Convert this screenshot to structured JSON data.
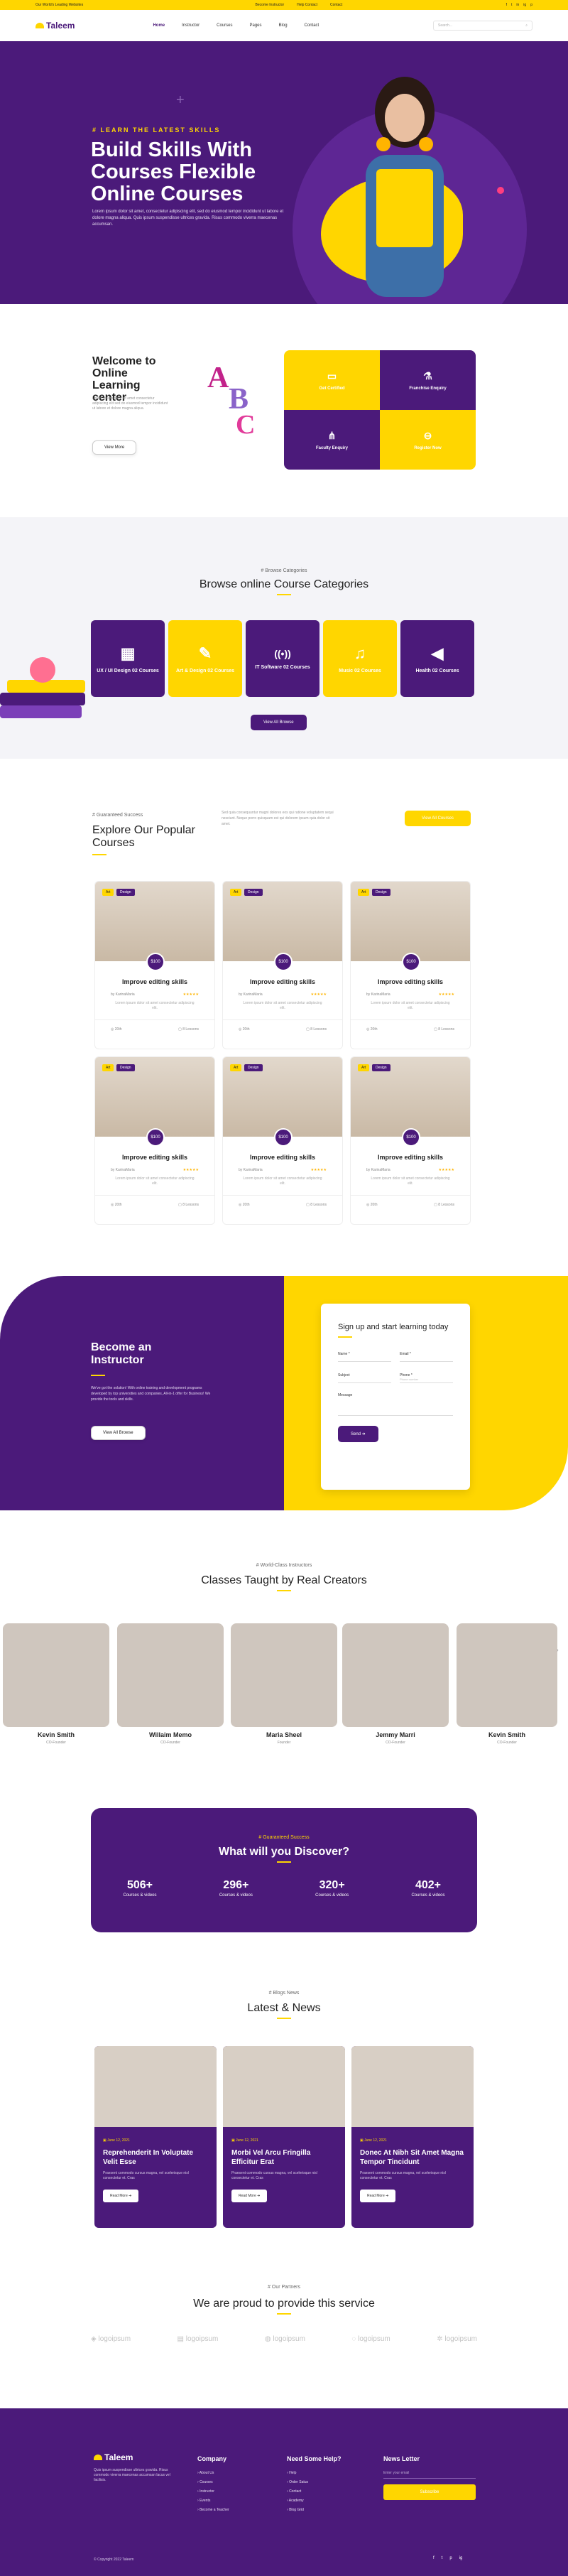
{
  "topbar": {
    "left": "Our World's Leading Websites",
    "links": [
      "Become Instructor",
      "Help Contact",
      "Contact"
    ],
    "social": [
      "f",
      "t",
      "in",
      "ig",
      "p"
    ]
  },
  "nav": {
    "logo": "Taleem",
    "menu": [
      "Home",
      "Instructor",
      "Courses",
      "Pages",
      "Blog",
      "Contact"
    ],
    "search_placeholder": "Search..."
  },
  "hero": {
    "kicker": "# LEARN THE LATEST SKILLS",
    "title": "Build Skills With Courses Flexible Online Courses",
    "text": "Lorem ipsum dolor sit amet, consectetur adipiscing elit, sed do eiusmod tempor incididunt ut labore et dolore magna aliqua. Quis ipsum suspendisse ultrices gravida. Risus commodo viverra maecenas accumsan."
  },
  "welcome": {
    "title": "Welcome to Online Learning center",
    "text": "Lorem ipsum dolor sit amet consectetur adipiscing elit sed do eiusmod tempor incididunt ut labore et dolore magna aliqua.",
    "button": "View More",
    "tiles": [
      {
        "label": "Get Certified",
        "icon": "certificate-icon",
        "glyph": "▭"
      },
      {
        "label": "Franchise Enquiry",
        "icon": "flask-icon",
        "glyph": "⚗"
      },
      {
        "label": "Faculty Enquiry",
        "icon": "network-icon",
        "glyph": "⋔"
      },
      {
        "label": "Register Now",
        "icon": "link-icon",
        "glyph": "⊖"
      }
    ]
  },
  "categories": {
    "kicker": "# Browse Categories",
    "title": "Browse online Course Categories",
    "items": [
      {
        "label": "UX / UI Design 02 Courses",
        "glyph": "▦"
      },
      {
        "label": "Art & Design 02 Courses",
        "glyph": "✎"
      },
      {
        "label": "IT Software 02 Courses",
        "glyph": "((•))"
      },
      {
        "label": "Music 02 Courses",
        "glyph": "♫"
      },
      {
        "label": "Health 02 Courses",
        "glyph": "◀"
      }
    ],
    "button": "View All Browse"
  },
  "courses": {
    "kicker": "# Guaranteed Success",
    "title": "Explore Our Popular Courses",
    "desc": "Sed quia consequuntur magni dolores eos qui ratione voluptatem sequi nesciunt. Neque porro quisquam est qui dolorem ipsum quia dolor sit amet.",
    "button": "View All Courses",
    "cards": [
      {
        "tag1": "Art",
        "tag2": "Design",
        "price": "$100",
        "title": "Improve editing skills",
        "author": "by KarinaMaria",
        "desc": "Lorem ipsum dolor sit amet consectetur adipiscing elit.",
        "students": "20th",
        "lessons": "8 Lessons"
      },
      {
        "tag1": "Art",
        "tag2": "Design",
        "price": "$100",
        "title": "Improve editing skills",
        "author": "by KarinaMaria",
        "desc": "Lorem ipsum dolor sit amet consectetur adipiscing elit.",
        "students": "20th",
        "lessons": "8 Lessons"
      },
      {
        "tag1": "Art",
        "tag2": "Design",
        "price": "$100",
        "title": "Improve editing skills",
        "author": "by KarinaMaria",
        "desc": "Lorem ipsum dolor sit amet consectetur adipiscing elit.",
        "students": "20th",
        "lessons": "8 Lessons"
      },
      {
        "tag1": "Art",
        "tag2": "Design",
        "price": "$100",
        "title": "Improve editing skills",
        "author": "by KarinaMaria",
        "desc": "Lorem ipsum dolor sit amet consectetur adipiscing elit.",
        "students": "20th",
        "lessons": "8 Lessons"
      },
      {
        "tag1": "Art",
        "tag2": "Design",
        "price": "$100",
        "title": "Improve editing skills",
        "author": "by KarinaMaria",
        "desc": "Lorem ipsum dolor sit amet consectetur adipiscing elit.",
        "students": "20th",
        "lessons": "8 Lessons"
      },
      {
        "tag1": "Art",
        "tag2": "Design",
        "price": "$100",
        "title": "Improve editing skills",
        "author": "by KarinaMaria",
        "desc": "Lorem ipsum dolor sit amet consectetur adipiscing elit.",
        "students": "20th",
        "lessons": "8 Lessons"
      }
    ]
  },
  "instructor": {
    "title": "Become an Instructor",
    "text": "We've got the solution! With online training and development programs developed by top universities and companies, All-in-1 offer for Business! We provide the tools and skills.",
    "button": "View All Browse",
    "form_title": "Sign up and start learning today",
    "fields": {
      "name": "Name *",
      "email": "Email *",
      "subject": "Subject",
      "phone": "Phone *",
      "message": "Message"
    },
    "phone_placeholder": "Phone number",
    "send": "Send"
  },
  "teachers": {
    "kicker": "# World-Class Instructors",
    "title": "Classes Taught by Real Creators",
    "items": [
      {
        "name": "Kevin Smith",
        "role": "CO-Founder"
      },
      {
        "name": "Willaim Memo",
        "role": "CO-Founder"
      },
      {
        "name": "Maria Sheel",
        "role": "Founder"
      },
      {
        "name": "Jemmy Marri",
        "role": "CO-Founder"
      },
      {
        "name": "Kevin Smith",
        "role": "CO-Founder"
      }
    ]
  },
  "discover": {
    "kicker": "# Guaranteed Success",
    "title": "What will you Discover?",
    "stats": [
      {
        "n": "506+",
        "l": "Courses & videos"
      },
      {
        "n": "296+",
        "l": "Courses & videos"
      },
      {
        "n": "320+",
        "l": "Courses & videos"
      },
      {
        "n": "402+",
        "l": "Courses & videos"
      }
    ]
  },
  "blog": {
    "kicker": "# Blogs News",
    "title": "Latest & News",
    "items": [
      {
        "date": "June 12, 2021",
        "title": "Reprehenderit In Voluptate Velit Esse",
        "desc": "Praesent commodo cursus magna, vel scelerisque nisl consectetur et. Cras",
        "btn": "Read More"
      },
      {
        "date": "June 12, 2021",
        "title": "Morbi Vel Arcu Fringilla Efficitur Erat",
        "desc": "Praesent commodo cursus magna, vel scelerisque nisl consectetur et. Cras",
        "btn": "Read More"
      },
      {
        "date": "June 12, 2021",
        "title": "Donec At Nibh Sit Amet Magna Tempor Tincidunt",
        "desc": "Praesent commodo cursus magna, vel scelerisque nisl consectetur et. Cras",
        "btn": "Read More"
      }
    ]
  },
  "partners": {
    "kicker": "# Our Partners",
    "title": "We are proud to provide this service",
    "logos": [
      "logoipsum",
      "logoipsum",
      "logoipsum",
      "logoipsum",
      "logoipsum"
    ]
  },
  "footer": {
    "logo": "Taleem",
    "about": "Quis ipsum suspendisse ultrices gravida. Risus commodo viverra maecenas accumsan lacus vel facilisis.",
    "company_title": "Company",
    "company": [
      "About Us",
      "Courses",
      "Instructor",
      "Events",
      "Become a Teacher"
    ],
    "help_title": "Need Some Help?",
    "help": [
      "Help",
      "Order Satus",
      "Contact",
      "Academy",
      "Blog Grid"
    ],
    "news_title": "News Letter",
    "news_placeholder": "Enter your email",
    "subscribe": "Subscribe",
    "copyright": "© Copyright 2022 Taleem",
    "social": [
      "f",
      "t",
      "p",
      "ig"
    ]
  },
  "colors": {
    "purple": "#4b1a7a",
    "yellow": "#ffd600"
  }
}
